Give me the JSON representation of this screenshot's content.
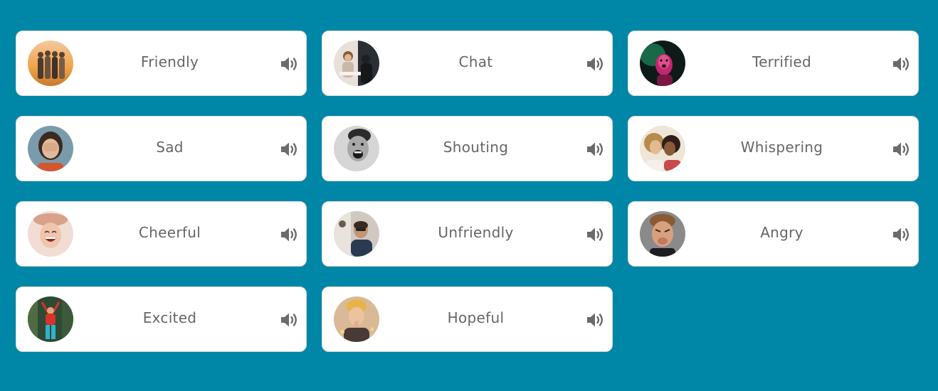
{
  "colors": {
    "background": "#0086a6",
    "card": "#ffffff",
    "text": "#666666",
    "icon": "#6b6b6b"
  },
  "voices": [
    {
      "label": "Friendly",
      "avatar_icon": "group-of-friends-sunset-avatar"
    },
    {
      "label": "Chat",
      "avatar_icon": "people-chatting-avatar"
    },
    {
      "label": "Terrified",
      "avatar_icon": "terrified-face-neon-avatar"
    },
    {
      "label": "Sad",
      "avatar_icon": "sad-covered-face-avatar"
    },
    {
      "label": "Shouting",
      "avatar_icon": "shouting-man-avatar"
    },
    {
      "label": "Whispering",
      "avatar_icon": "whispering-women-avatar"
    },
    {
      "label": "Cheerful",
      "avatar_icon": "cheerful-laughing-woman-avatar"
    },
    {
      "label": "Unfriendly",
      "avatar_icon": "unfriendly-man-avatar"
    },
    {
      "label": "Angry",
      "avatar_icon": "angry-man-avatar"
    },
    {
      "label": "Excited",
      "avatar_icon": "excited-person-forest-avatar"
    },
    {
      "label": "Hopeful",
      "avatar_icon": "hopeful-praying-woman-avatar"
    }
  ]
}
